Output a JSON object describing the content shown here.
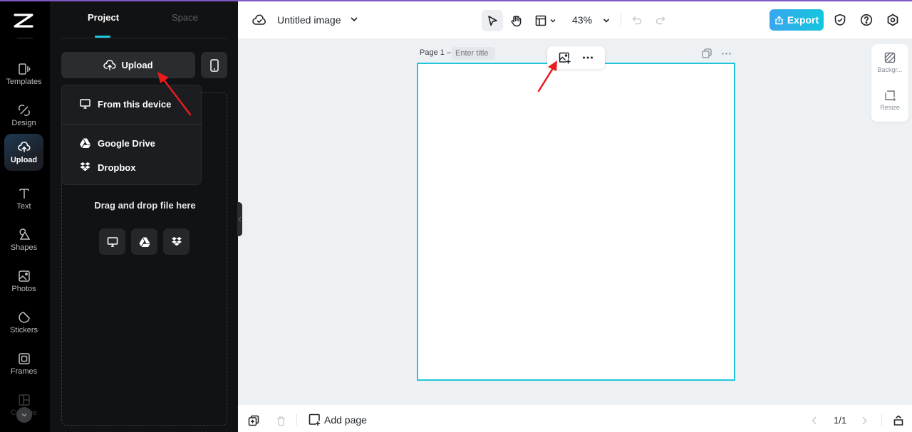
{
  "app": {
    "accent_color": "#1fc7dc",
    "top_bar_color": "#7e57c2"
  },
  "nav": {
    "items": [
      {
        "label": "Templates",
        "icon": "templates-icon"
      },
      {
        "label": "Design",
        "icon": "design-icon"
      },
      {
        "label": "Upload",
        "icon": "upload-cloud-icon",
        "active": true
      },
      {
        "label": "Text",
        "icon": "text-icon"
      },
      {
        "label": "Shapes",
        "icon": "shapes-icon"
      },
      {
        "label": "Photos",
        "icon": "photos-icon"
      },
      {
        "label": "Stickers",
        "icon": "stickers-icon"
      },
      {
        "label": "Frames",
        "icon": "frames-icon"
      },
      {
        "label": "Collage",
        "icon": "collage-icon"
      }
    ]
  },
  "panel": {
    "tabs": [
      {
        "label": "Project",
        "active": true
      },
      {
        "label": "Space",
        "active": false
      }
    ],
    "upload_label": "Upload",
    "menu": [
      {
        "label": "From this device",
        "icon": "monitor-icon"
      },
      {
        "label": "Google Drive",
        "icon": "google-drive-icon"
      },
      {
        "label": "Dropbox",
        "icon": "dropbox-icon"
      }
    ],
    "drop_text": "Drag and drop file here"
  },
  "header": {
    "title": "Untitled image",
    "zoom": "43%",
    "export_label": "Export",
    "export_color": "#2bb4e8"
  },
  "canvas": {
    "page_label": "Page 1 –",
    "title_placeholder": "Enter title",
    "side_tools": [
      {
        "label": "Backgr..."
      },
      {
        "label": "Resize"
      }
    ]
  },
  "footer": {
    "add_page_label": "Add page",
    "page_count": "1/1"
  }
}
